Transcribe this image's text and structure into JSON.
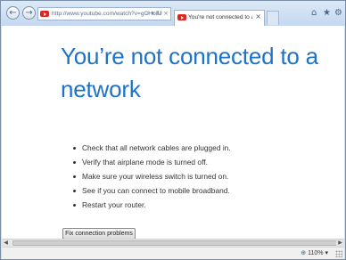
{
  "browser": {
    "nav": {
      "back_icon": "arrow-left-icon",
      "forward_icon": "arrow-right-icon"
    },
    "address": {
      "url": "http://www.youtube.com/watch?v=gCHo8J",
      "search_icon": "⌕",
      "dropdown_icon": "▾",
      "refresh_icon": "↻",
      "close_icon": "×"
    },
    "tab": {
      "title": "You're not connected to a ...",
      "close_label": "×"
    },
    "toolbar": {
      "home_icon": "⌂",
      "favorites_icon": "★",
      "tools_icon": "⚙"
    }
  },
  "page": {
    "headline": "You’re not connected to a network",
    "tips": [
      "Check that all network cables are plugged in.",
      "Verify that airplane mode is turned off.",
      "Make sure your wireless switch is turned on.",
      "See if you can connect to mobile broadband.",
      "Restart your router."
    ],
    "fix_button": "Fix connection problems"
  },
  "scrollbar": {
    "left_arrow": "◀",
    "right_arrow": "▶"
  },
  "status": {
    "zoom_icon": "⊕",
    "zoom": "110%",
    "zoom_dropdown": "▾"
  },
  "colors": {
    "accent": "#1f72c5",
    "youtube_red": "#dd2822"
  }
}
